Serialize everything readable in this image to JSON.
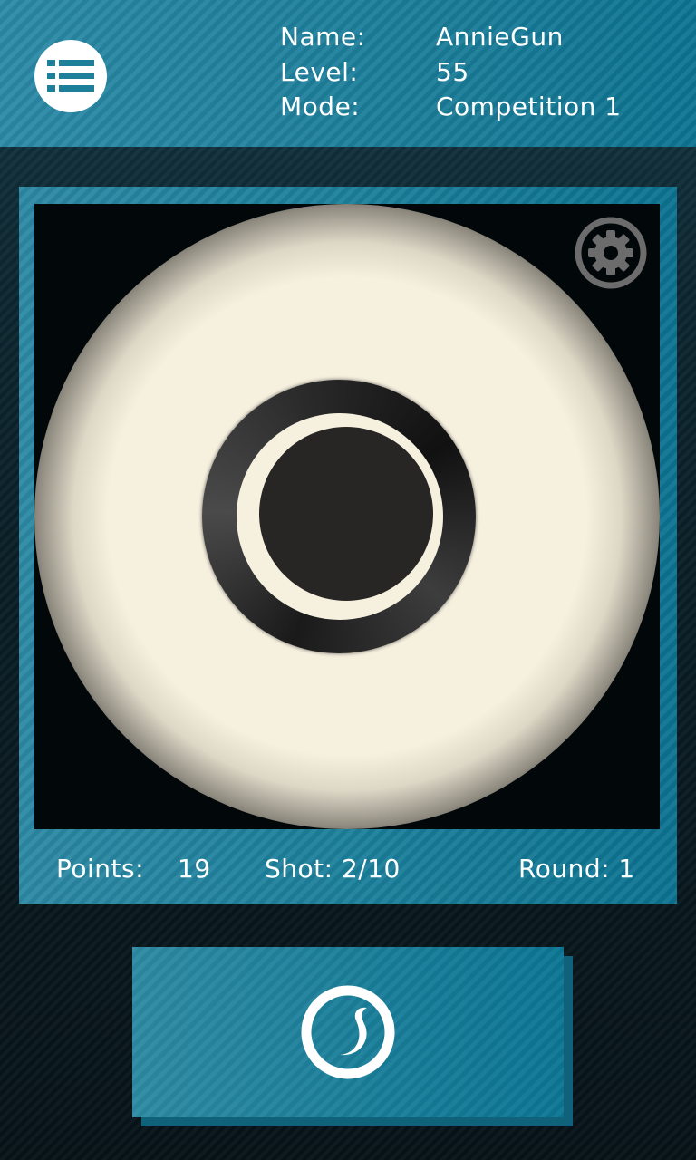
{
  "header": {
    "menu_icon": "list-menu-icon",
    "name_label": "Name:",
    "name_value": "AnnieGun",
    "level_label": "Level:",
    "level_value": "55",
    "mode_label": "Mode:",
    "mode_value": "Competition 1"
  },
  "target": {
    "settings_icon": "gear-icon"
  },
  "stats": {
    "points_label": "Points:",
    "points_value": "19",
    "shot": "Shot: 2/10",
    "round": "Round: 1"
  },
  "fire": {
    "icon": "shoot-icon"
  },
  "colors": {
    "accent": "#1b7f9b",
    "target_paper": "#f6f0df",
    "bullseye": "#282624",
    "background": "#0d2630"
  }
}
